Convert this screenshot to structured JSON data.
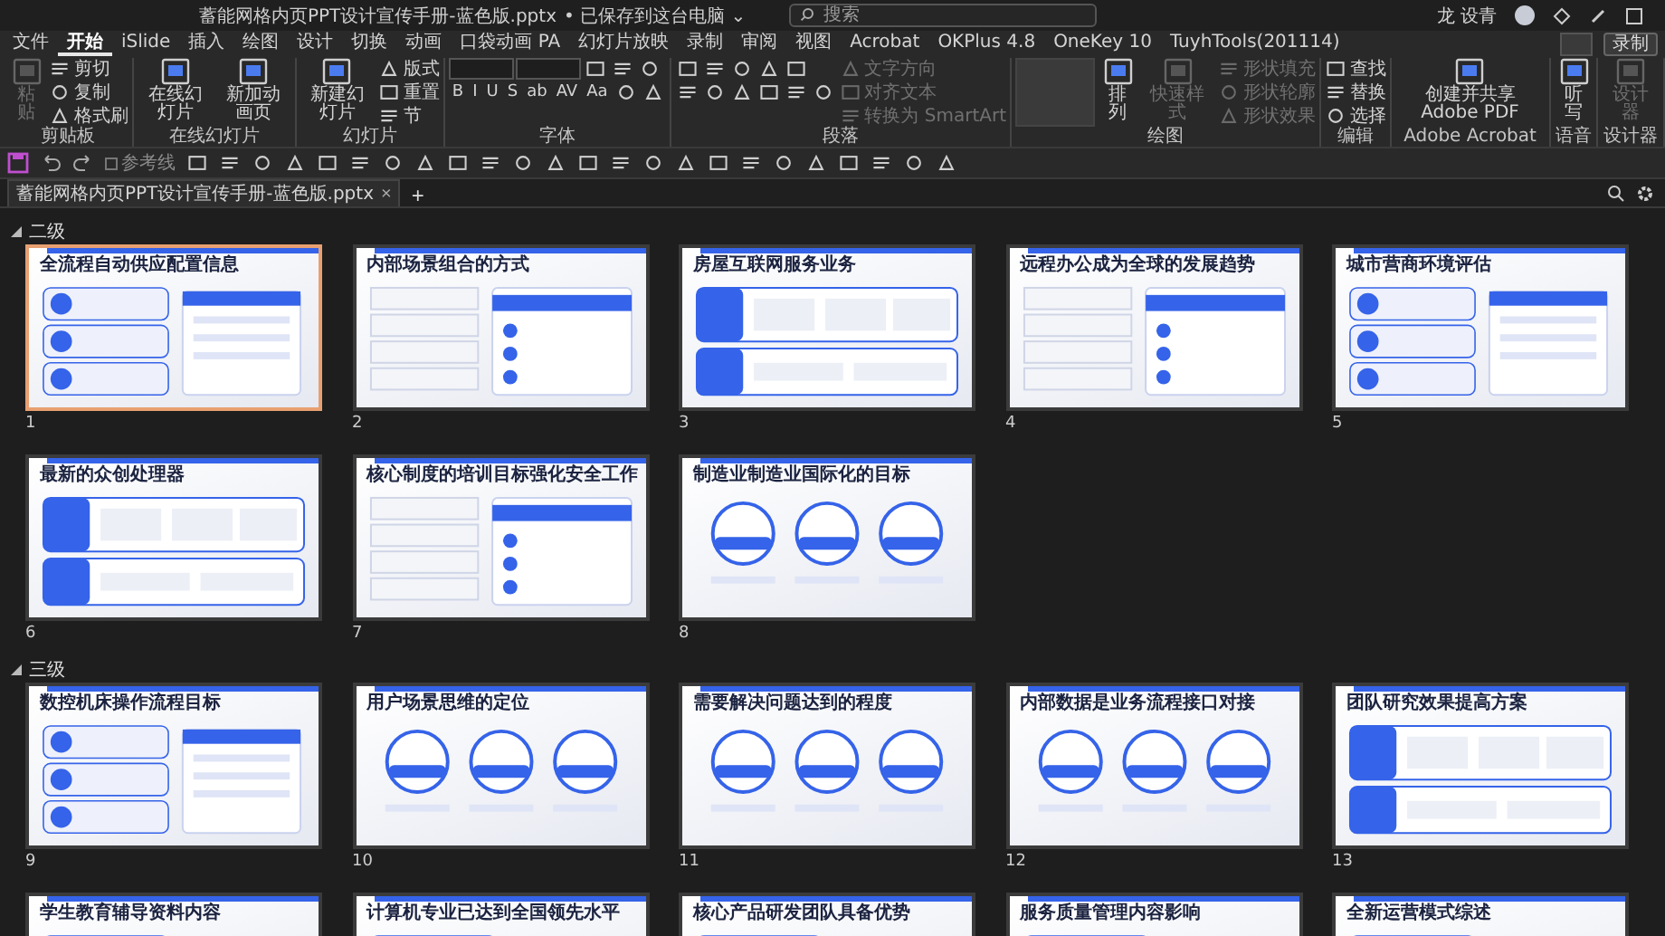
{
  "window": {
    "title": "蓄能网格内页PPT设计宣传手册-蓝色版.pptx",
    "saved_status": "• 已保存到这台电脑 ⌄",
    "search": {
      "placeholder": "搜索"
    },
    "user": "龙 设青"
  },
  "menu_tabs": [
    {
      "label": "文件",
      "selected": false
    },
    {
      "label": "开始",
      "selected": true
    },
    {
      "label": "iSlide",
      "selected": false
    },
    {
      "label": "插入",
      "selected": false
    },
    {
      "label": "绘图",
      "selected": false
    },
    {
      "label": "设计",
      "selected": false
    },
    {
      "label": "切换",
      "selected": false
    },
    {
      "label": "动画",
      "selected": false
    },
    {
      "label": "口袋动画 PA",
      "selected": false
    },
    {
      "label": "幻灯片放映",
      "selected": false
    },
    {
      "label": "录制",
      "selected": false
    },
    {
      "label": "审阅",
      "selected": false
    },
    {
      "label": "视图",
      "selected": false
    },
    {
      "label": "Acrobat",
      "selected": false
    },
    {
      "label": "OKPlus 4.8",
      "selected": false
    },
    {
      "label": "OneKey 10",
      "selected": false
    },
    {
      "label": "TuyhTools(201114)",
      "selected": false
    }
  ],
  "record_button": "录制",
  "ribbon_groups": [
    {
      "label": "剪贴板",
      "columns": [
        [
          [
            {
              "kind": "large",
              "label": "粘贴",
              "disabled": true
            }
          ]
        ],
        [
          [
            {
              "kind": "small",
              "label": "剪切",
              "disabled": false
            }
          ],
          [
            {
              "kind": "small",
              "label": "复制",
              "disabled": false
            }
          ],
          [
            {
              "kind": "small",
              "label": "格式刷",
              "disabled": false
            }
          ]
        ]
      ]
    },
    {
      "label": "在线幻灯片",
      "columns": [
        [
          [
            {
              "kind": "large",
              "label": "在线幻灯片",
              "disabled": false
            }
          ]
        ],
        [
          [
            {
              "kind": "large",
              "label": "新加动画页",
              "disabled": false
            }
          ]
        ]
      ]
    },
    {
      "label": "幻灯片",
      "columns": [
        [
          [
            {
              "kind": "large",
              "label": "新建幻灯片",
              "disabled": false
            }
          ]
        ],
        [
          [
            {
              "kind": "small",
              "label": "版式",
              "disabled": false
            }
          ],
          [
            {
              "kind": "small",
              "label": "重置",
              "disabled": false
            }
          ],
          [
            {
              "kind": "small",
              "label": "节",
              "disabled": false
            }
          ]
        ]
      ]
    },
    {
      "label": "字体",
      "columns": [
        [
          [
            {
              "kind": "field",
              "disabled": false
            },
            {
              "kind": "field",
              "disabled": false
            },
            {
              "kind": "icon",
              "disabled": false
            },
            {
              "kind": "icon",
              "disabled": false
            },
            {
              "kind": "icon",
              "disabled": false
            }
          ],
          [
            {
              "kind": "glyph",
              "label": "B",
              "disabled": false
            },
            {
              "kind": "glyph",
              "label": "I",
              "disabled": false
            },
            {
              "kind": "glyph",
              "label": "U",
              "disabled": false
            },
            {
              "kind": "glyph",
              "label": "S",
              "disabled": false
            },
            {
              "kind": "glyph",
              "label": "ab",
              "disabled": false
            },
            {
              "kind": "glyph",
              "label": "AV",
              "disabled": false
            },
            {
              "kind": "glyph",
              "label": "Aa",
              "disabled": false
            },
            {
              "kind": "icon",
              "disabled": false
            },
            {
              "kind": "icon",
              "disabled": false
            }
          ]
        ]
      ]
    },
    {
      "label": "段落",
      "columns": [
        [
          [
            {
              "kind": "icon",
              "disabled": false
            },
            {
              "kind": "icon",
              "disabled": false
            },
            {
              "kind": "icon",
              "disabled": false
            },
            {
              "kind": "icon",
              "disabled": false
            },
            {
              "kind": "icon",
              "disabled": false
            }
          ],
          [
            {
              "kind": "icon",
              "disabled": false
            },
            {
              "kind": "icon",
              "disabled": false
            },
            {
              "kind": "icon",
              "disabled": false
            },
            {
              "kind": "icon",
              "disabled": false
            },
            {
              "kind": "icon",
              "disabled": false
            },
            {
              "kind": "icon",
              "disabled": false
            }
          ]
        ],
        [
          [
            {
              "kind": "small",
              "label": "文字方向",
              "disabled": true
            }
          ],
          [
            {
              "kind": "small",
              "label": "对齐文本",
              "disabled": true
            }
          ],
          [
            {
              "kind": "small",
              "label": "转换为 SmartArt",
              "disabled": true
            }
          ]
        ]
      ]
    },
    {
      "label": "绘图",
      "columns": [
        [
          [
            {
              "kind": "gallery",
              "disabled": false
            }
          ]
        ],
        [
          [
            {
              "kind": "large",
              "label": "排列",
              "disabled": false
            }
          ]
        ],
        [
          [
            {
              "kind": "large",
              "label": "快速样式",
              "disabled": true
            }
          ]
        ],
        [
          [
            {
              "kind": "small",
              "label": "形状填充",
              "disabled": true
            }
          ],
          [
            {
              "kind": "small",
              "label": "形状轮廓",
              "disabled": true
            }
          ],
          [
            {
              "kind": "small",
              "label": "形状效果",
              "disabled": true
            }
          ]
        ]
      ]
    },
    {
      "label": "编辑",
      "columns": [
        [
          [
            {
              "kind": "small",
              "label": "查找",
              "disabled": false
            }
          ],
          [
            {
              "kind": "small",
              "label": "替换",
              "disabled": false
            }
          ],
          [
            {
              "kind": "small",
              "label": "选择",
              "disabled": false
            }
          ]
        ]
      ]
    },
    {
      "label": "Adobe Acrobat",
      "columns": [
        [
          [
            {
              "kind": "large",
              "label": "创建并共享 Adobe PDF",
              "disabled": false
            }
          ]
        ]
      ]
    },
    {
      "label": "语音",
      "columns": [
        [
          [
            {
              "kind": "large",
              "label": "听写",
              "disabled": false
            }
          ]
        ]
      ]
    },
    {
      "label": "设计器",
      "columns": [
        [
          [
            {
              "kind": "large",
              "label": "设计器",
              "disabled": true
            }
          ]
        ]
      ]
    }
  ],
  "quick_access": {
    "guides": {
      "label": "参考线",
      "checked": false
    }
  },
  "doc_tab": {
    "title": "蓄能网格内页PPT设计宣传手册-蓝色版.pptx",
    "close": "×",
    "new": "+"
  },
  "sections": [
    {
      "name": "二级",
      "expanded": true,
      "slides": [
        {
          "number": "1",
          "title": "全流程自动供应配置信息",
          "selected": true,
          "kind": "list"
        },
        {
          "number": "2",
          "title": "内部场景组合的方式",
          "selected": false,
          "kind": "panel"
        },
        {
          "number": "3",
          "title": "房屋互联网服务业务",
          "selected": false,
          "kind": "grid"
        },
        {
          "number": "4",
          "title": "远程办公成为全球的发展趋势",
          "selected": false,
          "kind": "panel"
        },
        {
          "number": "5",
          "title": "城市营商环境评估",
          "selected": false,
          "kind": "list"
        },
        {
          "number": "6",
          "title": "最新的众创处理器",
          "selected": false,
          "kind": "grid"
        },
        {
          "number": "7",
          "title": "核心制度的培训目标强化安全工作",
          "selected": false,
          "kind": "panel"
        },
        {
          "number": "8",
          "title": "制造业制造业国际化的目标",
          "selected": false,
          "kind": "circles"
        }
      ]
    },
    {
      "name": "三级",
      "expanded": true,
      "slides": [
        {
          "number": "9",
          "title": "数控机床操作流程目标",
          "selected": false,
          "kind": "list"
        },
        {
          "number": "10",
          "title": "用户场景思维的定位",
          "selected": false,
          "kind": "circles"
        },
        {
          "number": "11",
          "title": "需要解决问题达到的程度",
          "selected": false,
          "kind": "circles"
        },
        {
          "number": "12",
          "title": "内部数据是业务流程接口对接",
          "selected": false,
          "kind": "circles"
        },
        {
          "number": "13",
          "title": "团队研究效果提高方案",
          "selected": false,
          "kind": "grid"
        },
        {
          "title": "学生教育辅导资料内容",
          "selected": false,
          "kind": "list"
        },
        {
          "title": "计算机专业已达到全国领先水平",
          "selected": false,
          "kind": "list"
        },
        {
          "title": "核心产品研发团队具备优势",
          "selected": false,
          "kind": "list"
        },
        {
          "title": "服务质量管理内容影响",
          "selected": false,
          "kind": "list"
        },
        {
          "title": "全新运营模式综述",
          "selected": false,
          "kind": "list"
        }
      ]
    }
  ]
}
